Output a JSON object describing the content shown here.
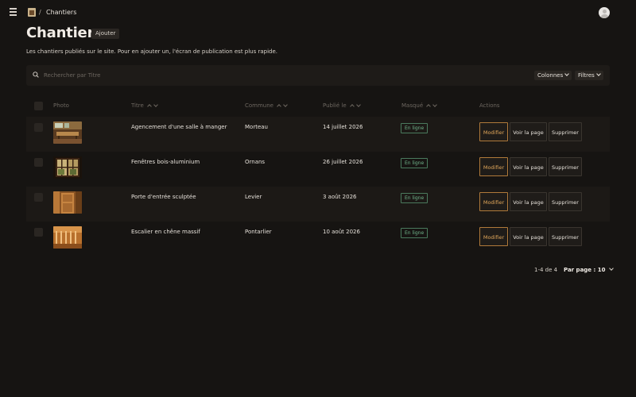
{
  "header": {
    "breadcrumb_separator": "/",
    "breadcrumb_current": "Chantiers"
  },
  "page": {
    "title": "Chantiers",
    "add_label": "Ajouter",
    "description": "Les chantiers publiés sur le site. Pour en ajouter un, l'écran de publication est plus rapide."
  },
  "toolbar": {
    "search_placeholder": "Rechercher par Titre",
    "columns_label": "Colonnes",
    "filters_label": "Filtres"
  },
  "table": {
    "headers": {
      "photo": "Photo",
      "title": "Titre",
      "commune": "Commune",
      "published": "Publié le",
      "hidden": "Masqué",
      "actions": "Actions"
    },
    "rows": [
      {
        "title": "Agencement d'une salle à manger",
        "commune": "Morteau",
        "published": "14 juillet 2026",
        "status": "En ligne",
        "thumb": "dining-room-photo"
      },
      {
        "title": "Fenêtres bois-aluminium",
        "commune": "Ornans",
        "published": "26 juillet 2026",
        "status": "En ligne",
        "thumb": "windows-photo"
      },
      {
        "title": "Porte d'entrée sculptée",
        "commune": "Levier",
        "published": "3 août 2026",
        "status": "En ligne",
        "thumb": "door-photo"
      },
      {
        "title": "Escalier en chêne massif",
        "commune": "Pontarlier",
        "published": "10 août 2026",
        "status": "En ligne",
        "thumb": "staircase-photo"
      }
    ],
    "actions": {
      "edit": "Modifier",
      "view": "Voir la page",
      "delete": "Supprimer"
    }
  },
  "pagination": {
    "range": "1-4 de 4",
    "per_page": "Par page : 10"
  },
  "colors": {
    "background": "#161412",
    "accent": "#e0a65a",
    "status_online": "#6fb38a"
  }
}
